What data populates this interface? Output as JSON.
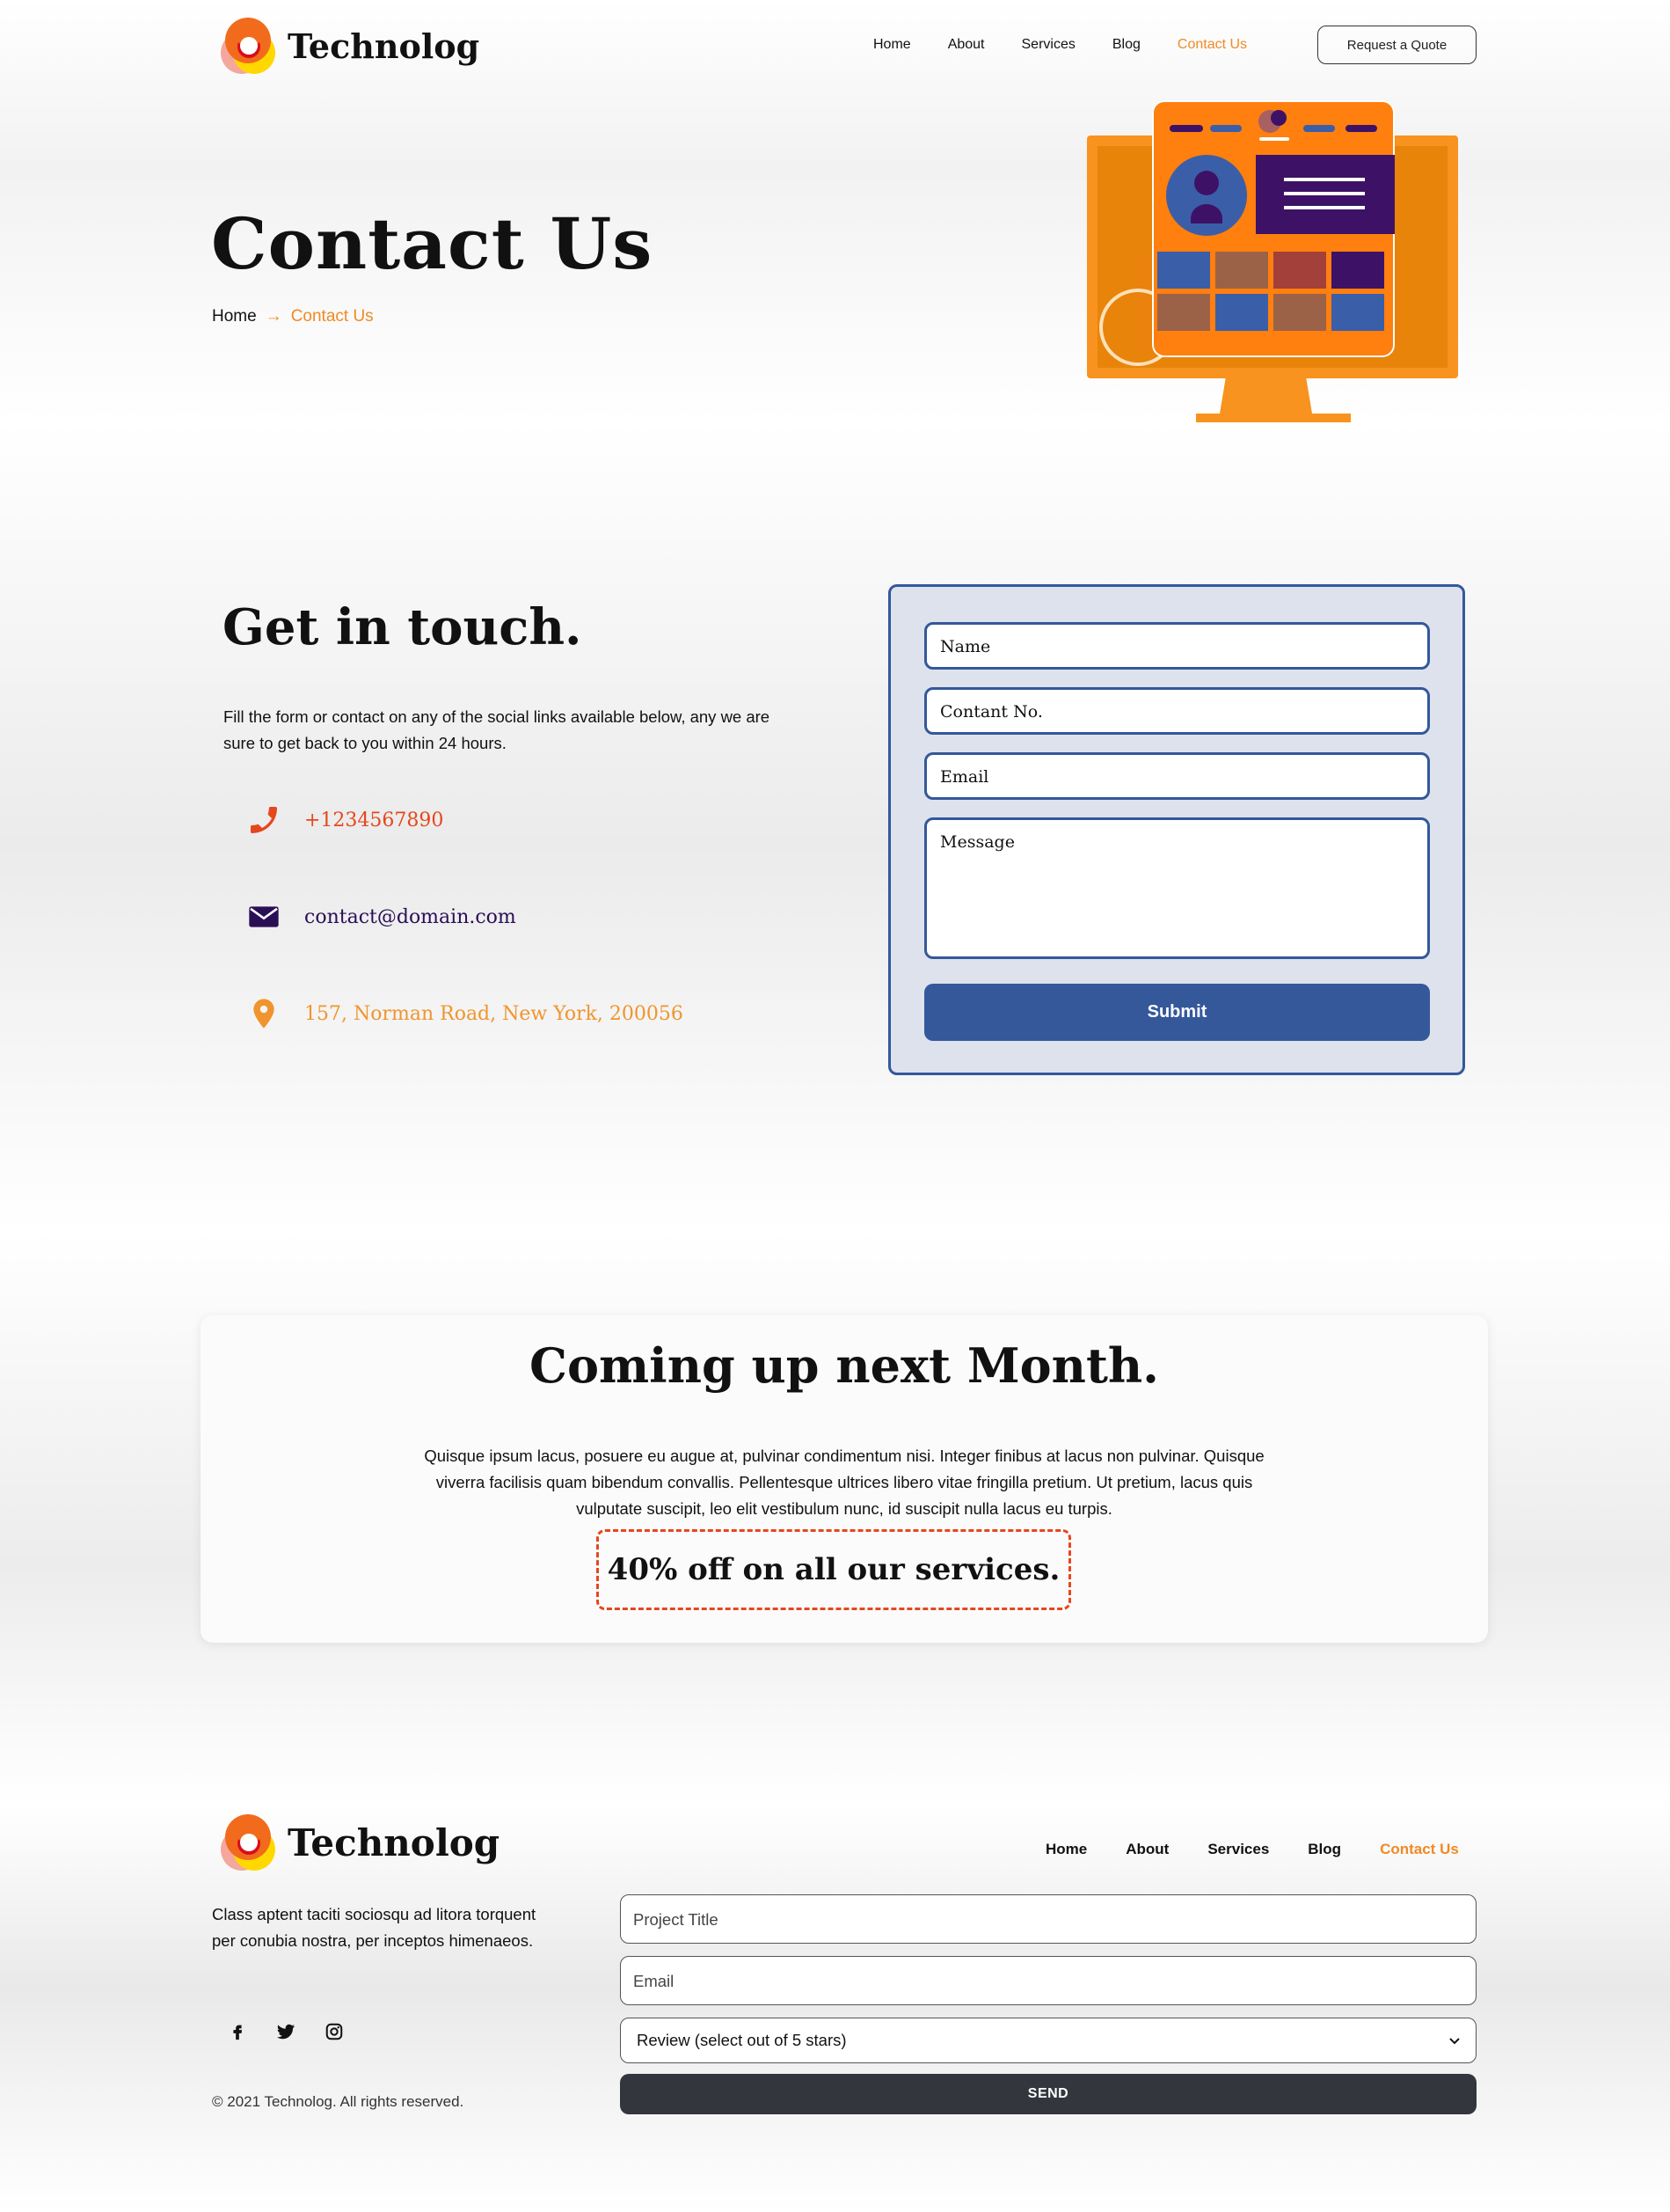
{
  "brand": {
    "name": "Technolog"
  },
  "nav": {
    "items": [
      {
        "label": "Home",
        "active": false
      },
      {
        "label": "About",
        "active": false
      },
      {
        "label": "Services",
        "active": false
      },
      {
        "label": "Blog",
        "active": false
      },
      {
        "label": "Contact Us",
        "active": true
      }
    ],
    "quote_button": "Request a Quote"
  },
  "hero": {
    "title": "Contact Us",
    "breadcrumb": {
      "home": "Home",
      "arrow": "→",
      "current": "Contact Us"
    }
  },
  "get_in_touch": {
    "title": "Get in touch.",
    "text": "Fill the form or contact on any of the social links available below, any we are sure to get back to you within 24 hours.",
    "phone": "+1234567890",
    "email": "contact@domain.com",
    "address": "157, Norman Road, New York, 200056"
  },
  "contact_form": {
    "name_placeholder": "Name",
    "phone_placeholder": "Contant No.",
    "email_placeholder": "Email",
    "message_placeholder": "Message",
    "submit_label": "Submit"
  },
  "promo": {
    "title": "Coming up next Month.",
    "text": "Quisque ipsum lacus, posuere eu augue at, pulvinar condimentum nisi. Integer finibus at lacus non pulvinar. Quisque viverra facilisis quam bibendum convallis. Pellentesque ultrices libero vitae fringilla pretium. Ut pretium, lacus quis vulputate suscipit, leo elit vestibulum nunc, id suscipit nulla lacus eu turpis.",
    "badge": "40% off on all our services."
  },
  "footer": {
    "description": "Class aptent taciti sociosqu ad litora torquent per conubia nostra, per inceptos himenaeos.",
    "socials": [
      "facebook-icon",
      "twitter-icon",
      "instagram-icon"
    ],
    "copyright": "© 2021 Technolog. All rights reserved.",
    "project_title_placeholder": "Project Title",
    "email_placeholder": "Email",
    "review_select": "Review (select out of 5 stars)",
    "send_label": "SEND"
  },
  "colors": {
    "accent_orange": "#f08a24",
    "phone_red": "#e5471d",
    "navy": "#2b0f55",
    "form_blue": "#34589a",
    "send_dark": "#33363d"
  }
}
